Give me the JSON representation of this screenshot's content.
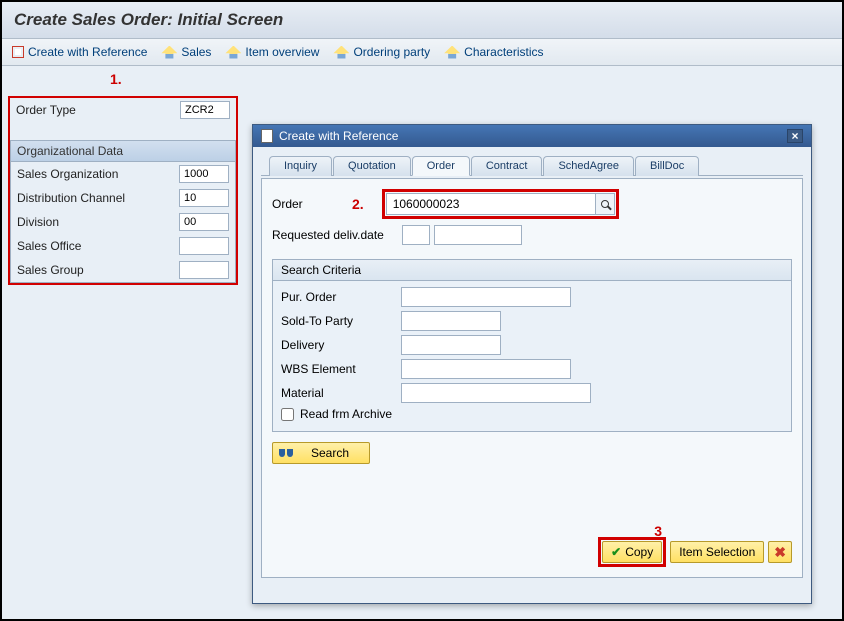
{
  "page_title": "Create Sales Order: Initial Screen",
  "toolbar": {
    "create_ref": "Create with Reference",
    "sales": "Sales",
    "item_overview": "Item overview",
    "ordering_party": "Ordering party",
    "characteristics": "Characteristics"
  },
  "annotations": {
    "a1": "1.",
    "a2": "2.",
    "a3": "3"
  },
  "order_type": {
    "label": "Order Type",
    "value": "ZCR2"
  },
  "org_data": {
    "title": "Organizational Data",
    "sales_org": {
      "label": "Sales Organization",
      "value": "1000"
    },
    "dist_channel": {
      "label": "Distribution Channel",
      "value": "10"
    },
    "division": {
      "label": "Division",
      "value": "00"
    },
    "sales_office": {
      "label": "Sales Office",
      "value": ""
    },
    "sales_group": {
      "label": "Sales Group",
      "value": ""
    }
  },
  "modal": {
    "title": "Create with Reference",
    "tabs": {
      "inquiry": "Inquiry",
      "quotation": "Quotation",
      "order": "Order",
      "contract": "Contract",
      "sched": "SchedAgree",
      "billdoc": "BillDoc"
    },
    "order_label": "Order",
    "order_value": "1060000023",
    "req_deliv": "Requested deliv.date",
    "search_criteria": {
      "title": "Search Criteria",
      "pur_order": "Pur. Order",
      "sold_to": "Sold-To Party",
      "delivery": "Delivery",
      "wbs": "WBS Element",
      "material": "Material",
      "archive": "Read frm Archive"
    },
    "search_btn": "Search",
    "copy_btn": "Copy",
    "item_sel_btn": "Item Selection"
  }
}
